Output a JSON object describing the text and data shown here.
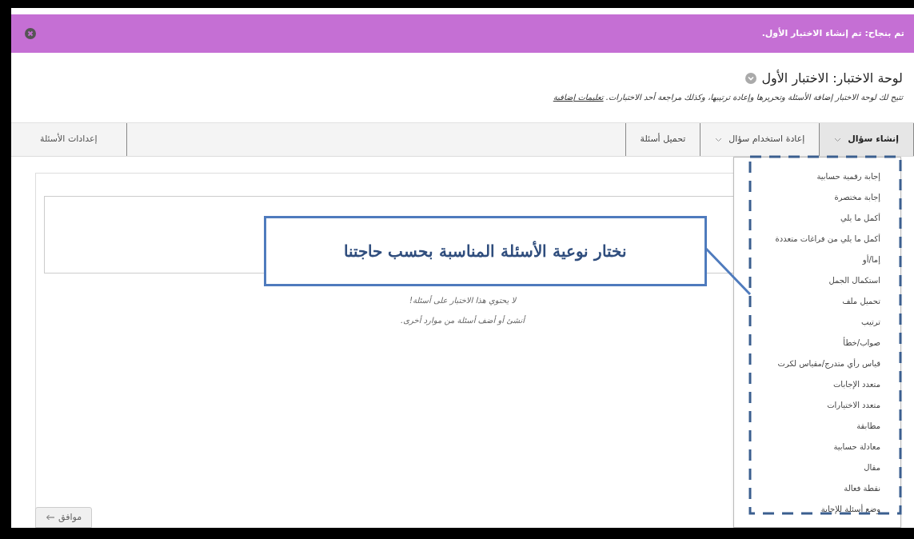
{
  "banner": {
    "text": "تم بنجاح: تم إنشاء الاختبار الأول."
  },
  "header": {
    "title": "لوحة الاختبار: الاختبار الأول",
    "description": "تتيح لك لوحة الاختبار إضافة الأسئلة وتحريرها وإعادة ترتيبها، وكذلك مراجعة أحد الاختبارات.",
    "link": "تعليمات إضافية"
  },
  "tabs": [
    {
      "label": "إنشاء سؤال",
      "selected": true,
      "dropdown": true
    },
    {
      "label": "إعادة استخدام سؤال",
      "selected": false,
      "dropdown": true
    },
    {
      "label": "تحميل أسئلة",
      "selected": false,
      "dropdown": false
    }
  ],
  "settings_tab": {
    "label": "إعدادات الأسئلة"
  },
  "empty_messages": [
    "لا يحتوي هذا الاختبار على أسئلة!",
    "أنشئ أو أضف أسئلة من موارد أخرى."
  ],
  "menu": {
    "items": [
      "إجابة رقمية حسابية",
      "إجابة مختصرة",
      "أكمل ما يلي",
      "أكمل ما يلي من فراغات متعددة",
      "إما/أو",
      "استكمال الجمل",
      "تحميل ملف",
      "ترتيب",
      "صواب/خطأ",
      "قياس رأي متدرج/مقياس لكرت",
      "متعدد الإجابات",
      "متعدد الاختيارات",
      "مطابقة",
      "معادلة حسابية",
      "مقال",
      "نقطة فعالة",
      "وضع أسئلة للإجابة"
    ]
  },
  "callout": {
    "text": "نختار نوعية الأسئلة المناسبة بحسب حاجتنا"
  },
  "ok_button": {
    "label": "موافق"
  }
}
